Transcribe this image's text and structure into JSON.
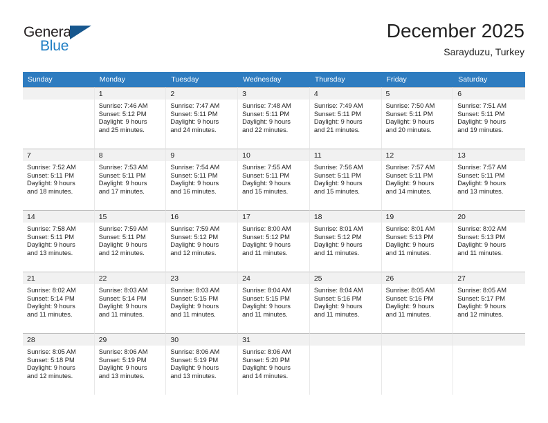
{
  "logo": {
    "word_top": "General",
    "word_bottom": "Blue",
    "triangle_color": "#17578e",
    "blue_color": "#1f7ec4"
  },
  "header": {
    "title": "December 2025",
    "subtitle": "Sarayduzu, Turkey"
  },
  "theme": {
    "header_row_bg": "#2e7cc0",
    "daynum_bg": "#f1f1f1",
    "text_color": "#222222"
  },
  "weekday_headers": [
    "Sunday",
    "Monday",
    "Tuesday",
    "Wednesday",
    "Thursday",
    "Friday",
    "Saturday"
  ],
  "weeks": [
    [
      {
        "day": "",
        "sunrise": "",
        "sunset": "",
        "daylight_line1": "",
        "daylight_line2": ""
      },
      {
        "day": "1",
        "sunrise": "Sunrise: 7:46 AM",
        "sunset": "Sunset: 5:12 PM",
        "daylight_line1": "Daylight: 9 hours",
        "daylight_line2": "and 25 minutes."
      },
      {
        "day": "2",
        "sunrise": "Sunrise: 7:47 AM",
        "sunset": "Sunset: 5:11 PM",
        "daylight_line1": "Daylight: 9 hours",
        "daylight_line2": "and 24 minutes."
      },
      {
        "day": "3",
        "sunrise": "Sunrise: 7:48 AM",
        "sunset": "Sunset: 5:11 PM",
        "daylight_line1": "Daylight: 9 hours",
        "daylight_line2": "and 22 minutes."
      },
      {
        "day": "4",
        "sunrise": "Sunrise: 7:49 AM",
        "sunset": "Sunset: 5:11 PM",
        "daylight_line1": "Daylight: 9 hours",
        "daylight_line2": "and 21 minutes."
      },
      {
        "day": "5",
        "sunrise": "Sunrise: 7:50 AM",
        "sunset": "Sunset: 5:11 PM",
        "daylight_line1": "Daylight: 9 hours",
        "daylight_line2": "and 20 minutes."
      },
      {
        "day": "6",
        "sunrise": "Sunrise: 7:51 AM",
        "sunset": "Sunset: 5:11 PM",
        "daylight_line1": "Daylight: 9 hours",
        "daylight_line2": "and 19 minutes."
      }
    ],
    [
      {
        "day": "7",
        "sunrise": "Sunrise: 7:52 AM",
        "sunset": "Sunset: 5:11 PM",
        "daylight_line1": "Daylight: 9 hours",
        "daylight_line2": "and 18 minutes."
      },
      {
        "day": "8",
        "sunrise": "Sunrise: 7:53 AM",
        "sunset": "Sunset: 5:11 PM",
        "daylight_line1": "Daylight: 9 hours",
        "daylight_line2": "and 17 minutes."
      },
      {
        "day": "9",
        "sunrise": "Sunrise: 7:54 AM",
        "sunset": "Sunset: 5:11 PM",
        "daylight_line1": "Daylight: 9 hours",
        "daylight_line2": "and 16 minutes."
      },
      {
        "day": "10",
        "sunrise": "Sunrise: 7:55 AM",
        "sunset": "Sunset: 5:11 PM",
        "daylight_line1": "Daylight: 9 hours",
        "daylight_line2": "and 15 minutes."
      },
      {
        "day": "11",
        "sunrise": "Sunrise: 7:56 AM",
        "sunset": "Sunset: 5:11 PM",
        "daylight_line1": "Daylight: 9 hours",
        "daylight_line2": "and 15 minutes."
      },
      {
        "day": "12",
        "sunrise": "Sunrise: 7:57 AM",
        "sunset": "Sunset: 5:11 PM",
        "daylight_line1": "Daylight: 9 hours",
        "daylight_line2": "and 14 minutes."
      },
      {
        "day": "13",
        "sunrise": "Sunrise: 7:57 AM",
        "sunset": "Sunset: 5:11 PM",
        "daylight_line1": "Daylight: 9 hours",
        "daylight_line2": "and 13 minutes."
      }
    ],
    [
      {
        "day": "14",
        "sunrise": "Sunrise: 7:58 AM",
        "sunset": "Sunset: 5:11 PM",
        "daylight_line1": "Daylight: 9 hours",
        "daylight_line2": "and 13 minutes."
      },
      {
        "day": "15",
        "sunrise": "Sunrise: 7:59 AM",
        "sunset": "Sunset: 5:11 PM",
        "daylight_line1": "Daylight: 9 hours",
        "daylight_line2": "and 12 minutes."
      },
      {
        "day": "16",
        "sunrise": "Sunrise: 7:59 AM",
        "sunset": "Sunset: 5:12 PM",
        "daylight_line1": "Daylight: 9 hours",
        "daylight_line2": "and 12 minutes."
      },
      {
        "day": "17",
        "sunrise": "Sunrise: 8:00 AM",
        "sunset": "Sunset: 5:12 PM",
        "daylight_line1": "Daylight: 9 hours",
        "daylight_line2": "and 11 minutes."
      },
      {
        "day": "18",
        "sunrise": "Sunrise: 8:01 AM",
        "sunset": "Sunset: 5:12 PM",
        "daylight_line1": "Daylight: 9 hours",
        "daylight_line2": "and 11 minutes."
      },
      {
        "day": "19",
        "sunrise": "Sunrise: 8:01 AM",
        "sunset": "Sunset: 5:13 PM",
        "daylight_line1": "Daylight: 9 hours",
        "daylight_line2": "and 11 minutes."
      },
      {
        "day": "20",
        "sunrise": "Sunrise: 8:02 AM",
        "sunset": "Sunset: 5:13 PM",
        "daylight_line1": "Daylight: 9 hours",
        "daylight_line2": "and 11 minutes."
      }
    ],
    [
      {
        "day": "21",
        "sunrise": "Sunrise: 8:02 AM",
        "sunset": "Sunset: 5:14 PM",
        "daylight_line1": "Daylight: 9 hours",
        "daylight_line2": "and 11 minutes."
      },
      {
        "day": "22",
        "sunrise": "Sunrise: 8:03 AM",
        "sunset": "Sunset: 5:14 PM",
        "daylight_line1": "Daylight: 9 hours",
        "daylight_line2": "and 11 minutes."
      },
      {
        "day": "23",
        "sunrise": "Sunrise: 8:03 AM",
        "sunset": "Sunset: 5:15 PM",
        "daylight_line1": "Daylight: 9 hours",
        "daylight_line2": "and 11 minutes."
      },
      {
        "day": "24",
        "sunrise": "Sunrise: 8:04 AM",
        "sunset": "Sunset: 5:15 PM",
        "daylight_line1": "Daylight: 9 hours",
        "daylight_line2": "and 11 minutes."
      },
      {
        "day": "25",
        "sunrise": "Sunrise: 8:04 AM",
        "sunset": "Sunset: 5:16 PM",
        "daylight_line1": "Daylight: 9 hours",
        "daylight_line2": "and 11 minutes."
      },
      {
        "day": "26",
        "sunrise": "Sunrise: 8:05 AM",
        "sunset": "Sunset: 5:16 PM",
        "daylight_line1": "Daylight: 9 hours",
        "daylight_line2": "and 11 minutes."
      },
      {
        "day": "27",
        "sunrise": "Sunrise: 8:05 AM",
        "sunset": "Sunset: 5:17 PM",
        "daylight_line1": "Daylight: 9 hours",
        "daylight_line2": "and 12 minutes."
      }
    ],
    [
      {
        "day": "28",
        "sunrise": "Sunrise: 8:05 AM",
        "sunset": "Sunset: 5:18 PM",
        "daylight_line1": "Daylight: 9 hours",
        "daylight_line2": "and 12 minutes."
      },
      {
        "day": "29",
        "sunrise": "Sunrise: 8:06 AM",
        "sunset": "Sunset: 5:19 PM",
        "daylight_line1": "Daylight: 9 hours",
        "daylight_line2": "and 13 minutes."
      },
      {
        "day": "30",
        "sunrise": "Sunrise: 8:06 AM",
        "sunset": "Sunset: 5:19 PM",
        "daylight_line1": "Daylight: 9 hours",
        "daylight_line2": "and 13 minutes."
      },
      {
        "day": "31",
        "sunrise": "Sunrise: 8:06 AM",
        "sunset": "Sunset: 5:20 PM",
        "daylight_line1": "Daylight: 9 hours",
        "daylight_line2": "and 14 minutes."
      },
      {
        "day": "",
        "sunrise": "",
        "sunset": "",
        "daylight_line1": "",
        "daylight_line2": ""
      },
      {
        "day": "",
        "sunrise": "",
        "sunset": "",
        "daylight_line1": "",
        "daylight_line2": ""
      },
      {
        "day": "",
        "sunrise": "",
        "sunset": "",
        "daylight_line1": "",
        "daylight_line2": ""
      }
    ]
  ]
}
